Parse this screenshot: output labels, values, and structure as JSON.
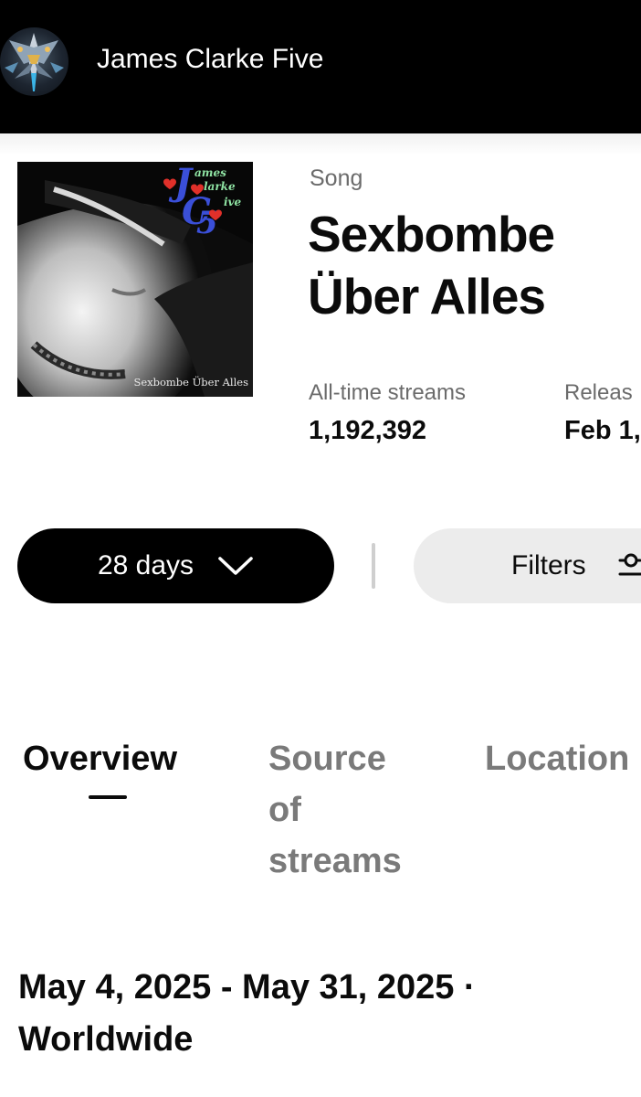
{
  "header": {
    "artist_name": "James Clarke Five",
    "avatar_icon": "spaceship-icon"
  },
  "song": {
    "kind_label": "Song",
    "title": "Sexbombe Über Alles",
    "cover": {
      "logo_line1": "ames",
      "logo_line2": "larke",
      "logo_line3": "ive",
      "caption": "Sexbombe Über Alles"
    },
    "stats": {
      "streams_label": "All-time streams",
      "streams_value": "1,192,392",
      "release_label": "Releas",
      "release_value": "Feb 1,"
    }
  },
  "controls": {
    "days_label": "28 days",
    "days_icon": "chevron-down-icon",
    "filters_label": "Filters",
    "filters_icon": "sliders-icon"
  },
  "tabs": [
    {
      "label": "Overview",
      "active": true
    },
    {
      "label": "Source of streams",
      "active": false
    },
    {
      "label": "Location",
      "active": false
    }
  ],
  "range": {
    "text": "May 4, 2025 - May 31, 2025 · Worldwide"
  },
  "colors": {
    "header_bg": "#000000",
    "primary_text": "#0b0b0b",
    "secondary_text": "#6b6b6b",
    "inactive_tab": "#7a7a7a",
    "filters_bg": "#ececec"
  }
}
